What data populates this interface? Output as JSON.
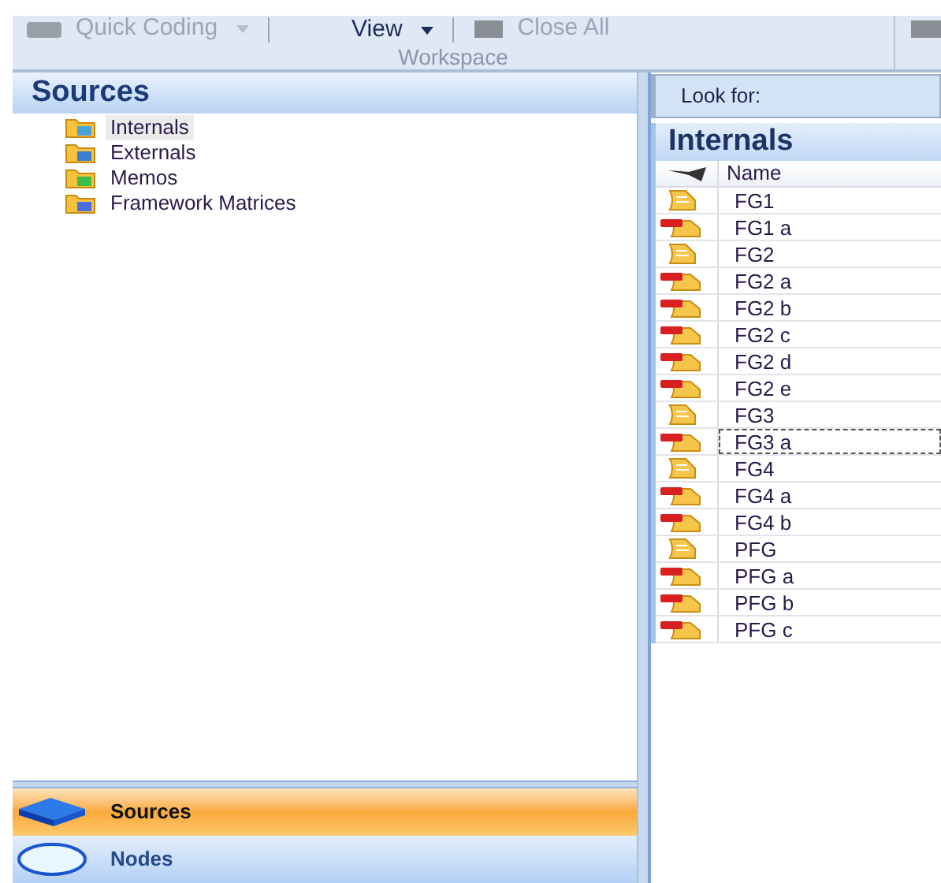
{
  "ribbon": {
    "items": [
      {
        "label": "Quick Coding",
        "kind": "dropdown-disabled"
      },
      {
        "label": "View",
        "kind": "dropdown"
      },
      {
        "label": "Close All",
        "kind": "button-disabled"
      }
    ],
    "group_label": "Workspace"
  },
  "sources_panel": {
    "title": "Sources",
    "tree": [
      {
        "label": "Internals",
        "selected": true
      },
      {
        "label": "Externals",
        "selected": false
      },
      {
        "label": "Memos",
        "selected": false
      },
      {
        "label": "Framework Matrices",
        "selected": false
      }
    ]
  },
  "navigation": [
    {
      "label": "Sources",
      "selected": true
    },
    {
      "label": "Nodes",
      "selected": false
    }
  ],
  "look_for": {
    "label": "Look for:"
  },
  "list_view": {
    "title": "Internals",
    "columns": [
      "Name"
    ],
    "rows": [
      {
        "name": "FG1",
        "kind": "document",
        "focused": false
      },
      {
        "name": "FG1 a",
        "kind": "pdf",
        "focused": false
      },
      {
        "name": "FG2",
        "kind": "document",
        "focused": false
      },
      {
        "name": "FG2 a",
        "kind": "pdf",
        "focused": false
      },
      {
        "name": "FG2 b",
        "kind": "pdf",
        "focused": false
      },
      {
        "name": "FG2 c",
        "kind": "pdf",
        "focused": false
      },
      {
        "name": "FG2 d",
        "kind": "pdf",
        "focused": false
      },
      {
        "name": "FG2 e",
        "kind": "pdf",
        "focused": false
      },
      {
        "name": "FG3",
        "kind": "document",
        "focused": false
      },
      {
        "name": "FG3 a",
        "kind": "pdf",
        "focused": true
      },
      {
        "name": "FG4",
        "kind": "document",
        "focused": false
      },
      {
        "name": "FG4 a",
        "kind": "pdf",
        "focused": false
      },
      {
        "name": "FG4 b",
        "kind": "pdf",
        "focused": false
      },
      {
        "name": "PFG",
        "kind": "document",
        "focused": false
      },
      {
        "name": "PFG a",
        "kind": "pdf",
        "focused": false
      },
      {
        "name": "PFG b",
        "kind": "pdf",
        "focused": false
      },
      {
        "name": "PFG c",
        "kind": "pdf",
        "focused": false
      }
    ]
  }
}
